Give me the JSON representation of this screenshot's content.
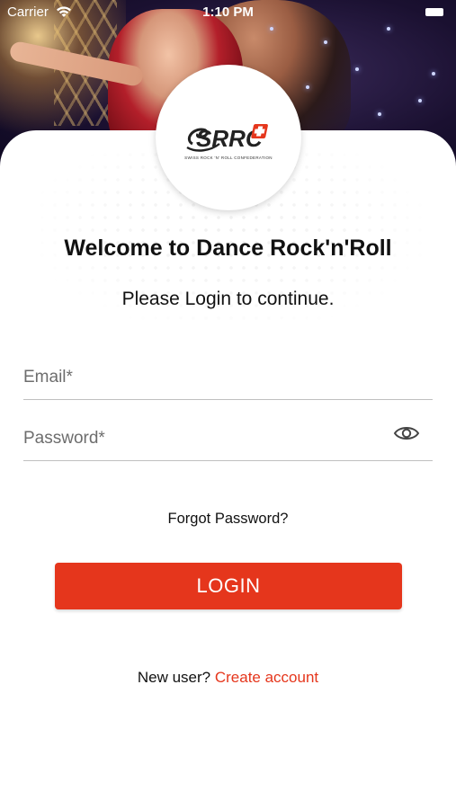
{
  "status_bar": {
    "carrier": "Carrier",
    "time": "1:10 PM",
    "wifi_icon": "wifi-icon",
    "battery_icon": "battery-icon"
  },
  "hero": {
    "image_subject": "dancing couple on stage"
  },
  "logo": {
    "mark": "SRRC",
    "caption": "SWISS ROCK 'N' ROLL CONFEDERATION",
    "accent": "#e5361c"
  },
  "welcome": {
    "title": "Welcome to Dance Rock'n'Roll",
    "subtitle": "Please Login to continue."
  },
  "form": {
    "email": {
      "placeholder": "Email*",
      "value": ""
    },
    "password": {
      "placeholder": "Password*",
      "value": "",
      "toggle_icon": "eye-icon"
    },
    "forgot_label": "Forgot Password?",
    "login_label": "LOGIN"
  },
  "footer": {
    "prompt": "New user?",
    "link": "Create account"
  },
  "colors": {
    "accent": "#e5361c",
    "text": "#111111",
    "placeholder": "#6d6d6d",
    "divider": "#bfbfbf"
  }
}
